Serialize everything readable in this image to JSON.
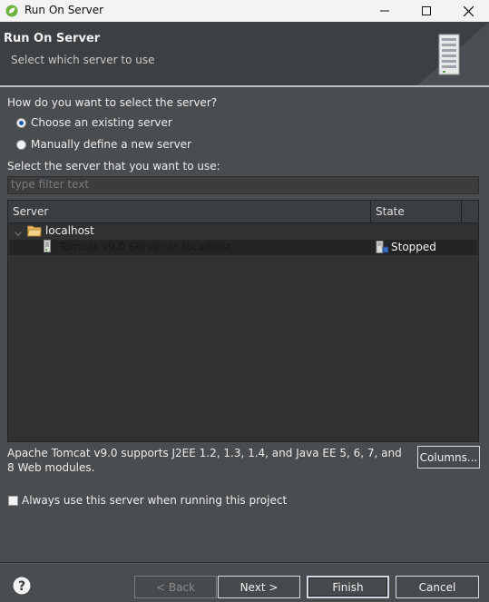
{
  "window": {
    "title": "Run On Server"
  },
  "banner": {
    "title": "Run On Server",
    "subtitle": "Select which server to use"
  },
  "selection": {
    "question": "How do you want to select the server?",
    "options": [
      {
        "label": "Choose an existing server",
        "selected": true
      },
      {
        "label": "Manually define a new server",
        "selected": false
      }
    ],
    "list_label": "Select the server that you want to use:",
    "filter_placeholder": "type filter text"
  },
  "table": {
    "columns": [
      "Server",
      "State"
    ],
    "host": "localhost",
    "rows": [
      {
        "server": "Tomcat v9.0 Server at localhost",
        "state": "Stopped"
      }
    ]
  },
  "description": "Apache Tomcat v9.0 supports J2EE 1.2, 1.3, 1.4, and Java EE 5, 6, 7, and 8 Web modules.",
  "buttons": {
    "columns": "Columns...",
    "back": "< Back",
    "next": "Next >",
    "finish": "Finish",
    "cancel": "Cancel"
  },
  "always_use": {
    "label": "Always use this server when running this project",
    "checked": false
  },
  "icons": [
    "spring-leaf-icon",
    "minimize-icon",
    "maximize-icon",
    "close-icon",
    "server-banner-icon",
    "folder-icon",
    "server-icon",
    "stopped-server-icon",
    "help-icon",
    "tree-collapse-icon"
  ]
}
